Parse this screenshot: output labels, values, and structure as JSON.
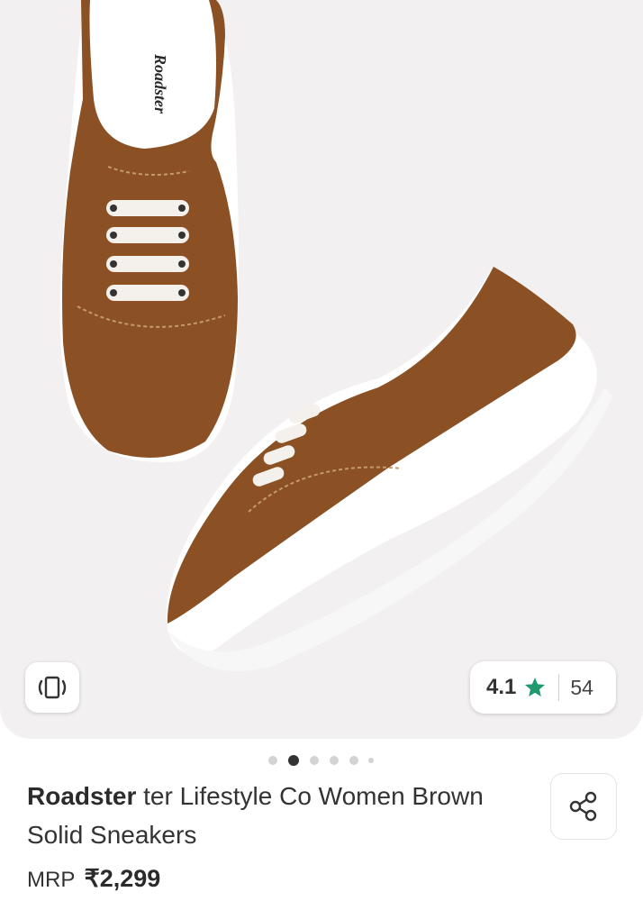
{
  "gallery": {
    "image_alt": "Brown canvas sneakers with white laces and white soles",
    "brand_label_on_insole": "Roadster",
    "rating": {
      "value": "4.1",
      "count": "54",
      "star_color": "#1f9a6e"
    },
    "carousel": {
      "total": 6,
      "active_index": 1
    }
  },
  "product": {
    "brand": "Roadster",
    "title_rest": "ter Lifestyle Co Women Brown Solid Sneakers",
    "price_label": "MRP",
    "price": "₹2,299"
  },
  "icons": {
    "view_in_room": "ar-view-icon",
    "share": "share-icon",
    "rating": "star-icon"
  }
}
